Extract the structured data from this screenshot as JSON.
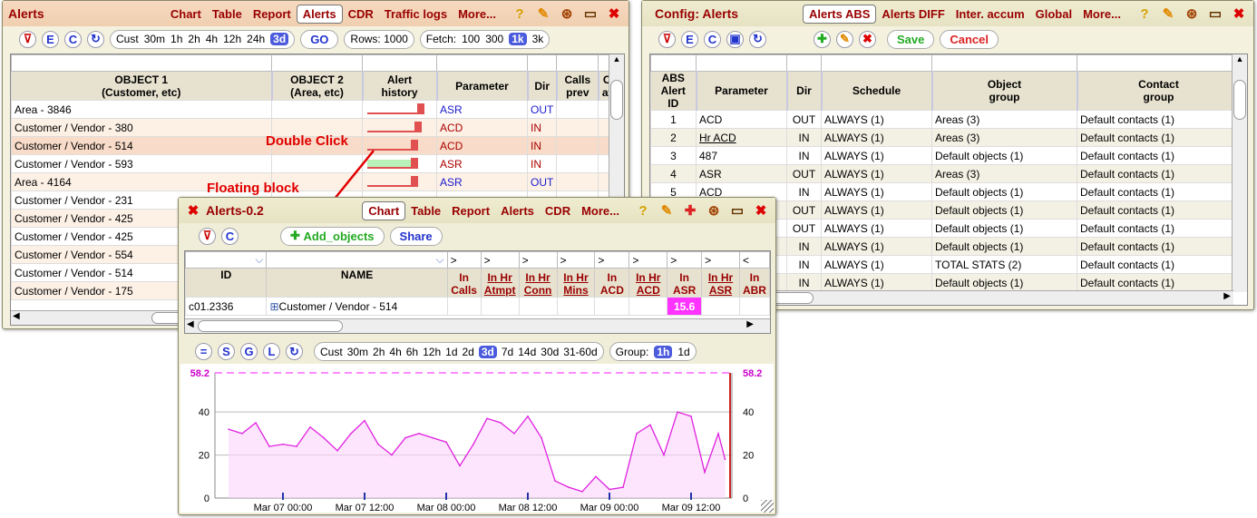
{
  "alerts": {
    "title": "Alerts",
    "tabs": [
      "Chart",
      "Table",
      "Report",
      "Alerts",
      "CDR",
      "Traffic logs",
      "More..."
    ],
    "active_tab": "Alerts",
    "tools": [
      "E",
      "C"
    ],
    "time_options": [
      "Cust",
      "30m",
      "1h",
      "2h",
      "4h",
      "12h",
      "24h",
      "3d"
    ],
    "time_selected": "3d",
    "go": "GO",
    "rows_label": "Rows: 1000",
    "fetch_label": "Fetch:",
    "fetch_options": [
      "100",
      "300",
      "1k",
      "3k"
    ],
    "fetch_selected": "1k",
    "columns": [
      "OBJECT 1\n(Customer, etc)",
      "OBJECT 2\n(Area, etc)",
      "Alert\nhistory",
      "Parameter",
      "Dir",
      "Calls\nprev",
      "C\nat"
    ],
    "rows": [
      {
        "obj1": "Area - 3846",
        "param": "ASR",
        "dir": "OUT",
        "hist": 0.9,
        "style": "r1",
        "pc": "blue"
      },
      {
        "obj1": "Customer / Vendor - 380",
        "param": "ACD",
        "dir": "IN",
        "hist": 0.85,
        "style": "r2",
        "pc": "red"
      },
      {
        "obj1": "Customer / Vendor - 514",
        "param": "ACD",
        "dir": "IN",
        "hist": 0.8,
        "style": "rsel",
        "pc": "red"
      },
      {
        "obj1": "Customer / Vendor - 593",
        "param": "ASR",
        "dir": "IN",
        "hist": 0.8,
        "style": "r1",
        "pc": "red"
      },
      {
        "obj1": "Area - 4164",
        "param": "ASR",
        "dir": "OUT",
        "hist": 0.8,
        "style": "r2",
        "pc": "blue"
      },
      {
        "obj1": "Customer / Vendor - 231",
        "param": "",
        "dir": "",
        "hist": 0,
        "style": "r1",
        "pc": "red"
      },
      {
        "obj1": "Customer / Vendor - 425",
        "param": "",
        "dir": "",
        "hist": 0,
        "style": "r2",
        "pc": "red"
      },
      {
        "obj1": "Customer / Vendor - 425",
        "param": "",
        "dir": "",
        "hist": 0,
        "style": "r1",
        "pc": "red"
      },
      {
        "obj1": "Customer / Vendor - 554",
        "param": "",
        "dir": "",
        "hist": 0,
        "style": "r2",
        "pc": "red"
      },
      {
        "obj1": "Customer / Vendor - 514",
        "param": "",
        "dir": "",
        "hist": 0,
        "style": "r1",
        "pc": "red"
      },
      {
        "obj1": "Customer / Vendor - 175",
        "param": "",
        "dir": "",
        "hist": 0,
        "style": "r2",
        "pc": "red"
      }
    ]
  },
  "config": {
    "title": "Config: Alerts",
    "tabs": [
      "Alerts ABS",
      "Alerts DIFF",
      "Inter. accum",
      "Global",
      "More..."
    ],
    "active_tab": "Alerts ABS",
    "save": "Save",
    "cancel": "Cancel",
    "columns": [
      "ABS\nAlert ID",
      "Parameter",
      "Dir",
      "Schedule",
      "Object\ngroup",
      "Contact\ngroup"
    ],
    "rows": [
      {
        "id": "1",
        "param": "ACD",
        "dir": "OUT",
        "sched": "ALWAYS (1)",
        "obj": "Areas (3)",
        "contact": "Default contacts (1)",
        "u": false
      },
      {
        "id": "2",
        "param": "Hr ACD",
        "dir": "IN",
        "sched": "ALWAYS (1)",
        "obj": "Areas (3)",
        "contact": "Default contacts (1)",
        "u": true
      },
      {
        "id": "3",
        "param": "487",
        "dir": "IN",
        "sched": "ALWAYS (1)",
        "obj": "Default objects (1)",
        "contact": "Default contacts (1)",
        "u": false
      },
      {
        "id": "4",
        "param": "ASR",
        "dir": "OUT",
        "sched": "ALWAYS (1)",
        "obj": "Areas (3)",
        "contact": "Default contacts (1)",
        "u": false
      },
      {
        "id": "5",
        "param": "ACD",
        "dir": "IN",
        "sched": "ALWAYS (1)",
        "obj": "Default objects (1)",
        "contact": "Default contacts (1)",
        "u": false
      },
      {
        "id": "",
        "param": "",
        "dir": "OUT",
        "sched": "ALWAYS (1)",
        "obj": "Default objects (1)",
        "contact": "Default contacts (1)",
        "u": false
      },
      {
        "id": "",
        "param": "",
        "dir": "OUT",
        "sched": "ALWAYS (1)",
        "obj": "Default objects (1)",
        "contact": "Default contacts (1)",
        "u": false
      },
      {
        "id": "",
        "param": "",
        "dir": "IN",
        "sched": "ALWAYS (1)",
        "obj": "Default objects (1)",
        "contact": "Default contacts (1)",
        "u": false
      },
      {
        "id": "",
        "param": "",
        "dir": "IN",
        "sched": "ALWAYS (1)",
        "obj": "TOTAL STATS (2)",
        "contact": "Default contacts (1)",
        "u": false
      },
      {
        "id": "",
        "param": "",
        "dir": "IN",
        "sched": "ALWAYS (1)",
        "obj": "Default objects (1)",
        "contact": "Default contacts (1)",
        "u": false
      }
    ]
  },
  "floating": {
    "title": "Alerts-0.2",
    "tabs": [
      "Chart",
      "Table",
      "Report",
      "Alerts",
      "CDR",
      "More..."
    ],
    "active_tab": "Chart",
    "add_objects": "Add_objects",
    "share": "Share",
    "filter_marks": [
      ">",
      ">",
      ">",
      ">",
      ">",
      ">",
      ">",
      ">",
      "<"
    ],
    "columns": [
      "ID",
      "NAME",
      "In\nCalls",
      "In Hr\nAtmpt",
      "In Hr\nConn",
      "In Hr\nMins",
      "In\nACD",
      "In Hr\nACD",
      "In\nASR",
      "In Hr\nASR",
      "In\nABR"
    ],
    "row": {
      "id": "c01.2336",
      "name": "Customer / Vendor - 514",
      "asr": "15.6"
    },
    "chart_tools": [
      "=",
      "S",
      "G",
      "L"
    ],
    "time_options": [
      "Cust",
      "30m",
      "2h",
      "4h",
      "6h",
      "12h",
      "1d",
      "2d",
      "3d",
      "7d",
      "14d",
      "30d",
      "31-60d"
    ],
    "time_selected": "3d",
    "group_label": "Group:",
    "group_options": [
      "1h",
      "1d"
    ],
    "group_selected": "1h"
  },
  "annotations": {
    "double_click": "Double Click",
    "floating_block": "Floating block"
  },
  "chart_data": {
    "type": "area",
    "title": "",
    "ylim": [
      0,
      58.2
    ],
    "threshold": 58.2,
    "yticks": [
      0,
      20,
      40
    ],
    "xticks": [
      "Mar 07 00:00",
      "Mar 07 12:00",
      "Mar 08 00:00",
      "Mar 08 12:00",
      "Mar 09 00:00",
      "Mar 09 12:00"
    ],
    "x_unit": "hours since Mar 07 00:00",
    "x": [
      -8,
      -6,
      -4,
      -2,
      0,
      2,
      4,
      6,
      8,
      10,
      12,
      14,
      16,
      18,
      20,
      22,
      24,
      26,
      28,
      30,
      32,
      34,
      36,
      38,
      40,
      42,
      44,
      46,
      48,
      50,
      52,
      54,
      56,
      58,
      60,
      62,
      64,
      65
    ],
    "values": [
      32,
      30,
      35,
      24,
      25,
      24,
      33,
      28,
      22,
      30,
      36,
      25,
      20,
      28,
      30,
      28,
      26,
      15,
      25,
      37,
      35,
      30,
      38,
      28,
      8,
      5,
      3,
      10,
      4,
      5,
      30,
      34,
      20,
      40,
      38,
      12,
      30,
      18
    ],
    "color": "#e020e0",
    "threshold_color": "#ff66ff",
    "grid": true
  }
}
